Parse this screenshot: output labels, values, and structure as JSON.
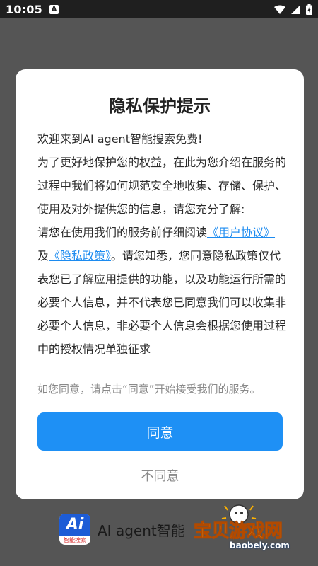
{
  "status_bar": {
    "time": "10:05",
    "notification_icon": "A",
    "icons": [
      "wifi-icon",
      "signal-icon",
      "battery-icon"
    ]
  },
  "dialog": {
    "title": "隐私保护提示",
    "welcome": "欢迎来到AI agent智能搜索免费!",
    "intro": "为了更好地保护您的权益，在此为您介绍在服务的过程中我们将如何规范安全地收集、存储、保护、使用及对外提供您的信息，请您充分了解:",
    "read_prefix": "请您在使用我们的服务前仔细阅读",
    "user_agreement_link": "《用户协议》",
    "and": "及",
    "privacy_policy_link": "《隐私政策》",
    "read_suffix": "。请您知悉，您同意隐私政策仅代表您已了解应用提供的功能，以及功能运行所需的必要个人信息，并不代表您已同意我们可以收集非必要个人信息，非必要个人信息会根据您使用过程中的授权情况单独征求",
    "hint": "如您同意，请点击“同意”开始接受我们的服务。",
    "agree_label": "同意",
    "disagree_label": "不同意"
  },
  "background_app": {
    "logo_text": "Ai",
    "logo_sub": "智能搜索",
    "name": "AI agent智能"
  },
  "watermark": {
    "text": "宝贝游戏网",
    "url": "baobeiy.com"
  },
  "colors": {
    "accent": "#1e90f5",
    "link": "#1c8bf0",
    "overlay": "#555555"
  }
}
